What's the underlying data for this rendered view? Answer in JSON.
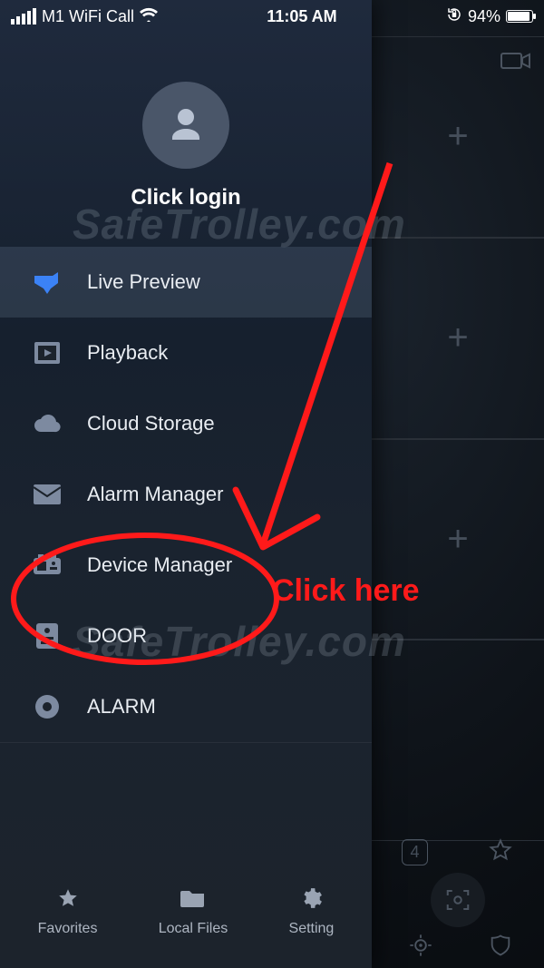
{
  "status": {
    "carrier": "M1 WiFi Call",
    "time": "11:05 AM",
    "battery_pct": "94%",
    "battery_fill_pct": 94
  },
  "drawer": {
    "login_cta": "Click login",
    "menu": [
      {
        "label": "Live Preview",
        "icon": "camera-icon",
        "active": true
      },
      {
        "label": "Playback",
        "icon": "film-icon",
        "active": false
      },
      {
        "label": "Cloud Storage",
        "icon": "cloud-icon",
        "active": false
      },
      {
        "label": "Alarm Manager",
        "icon": "mail-icon",
        "active": false
      },
      {
        "label": "Device Manager",
        "icon": "device-icon",
        "active": false
      },
      {
        "label": "DOOR",
        "icon": "intercom-icon",
        "active": false
      },
      {
        "label": "ALARM",
        "icon": "disc-icon",
        "active": false
      }
    ],
    "tabs": [
      {
        "label": "Favorites",
        "icon": "star-icon"
      },
      {
        "label": "Local Files",
        "icon": "folder-icon"
      },
      {
        "label": "Setting",
        "icon": "gear-icon"
      }
    ]
  },
  "background": {
    "grid_badge": "4"
  },
  "annotation": {
    "text": "Click here",
    "watermark": "SafeTrolley.com",
    "color": "#ff1a1a"
  }
}
